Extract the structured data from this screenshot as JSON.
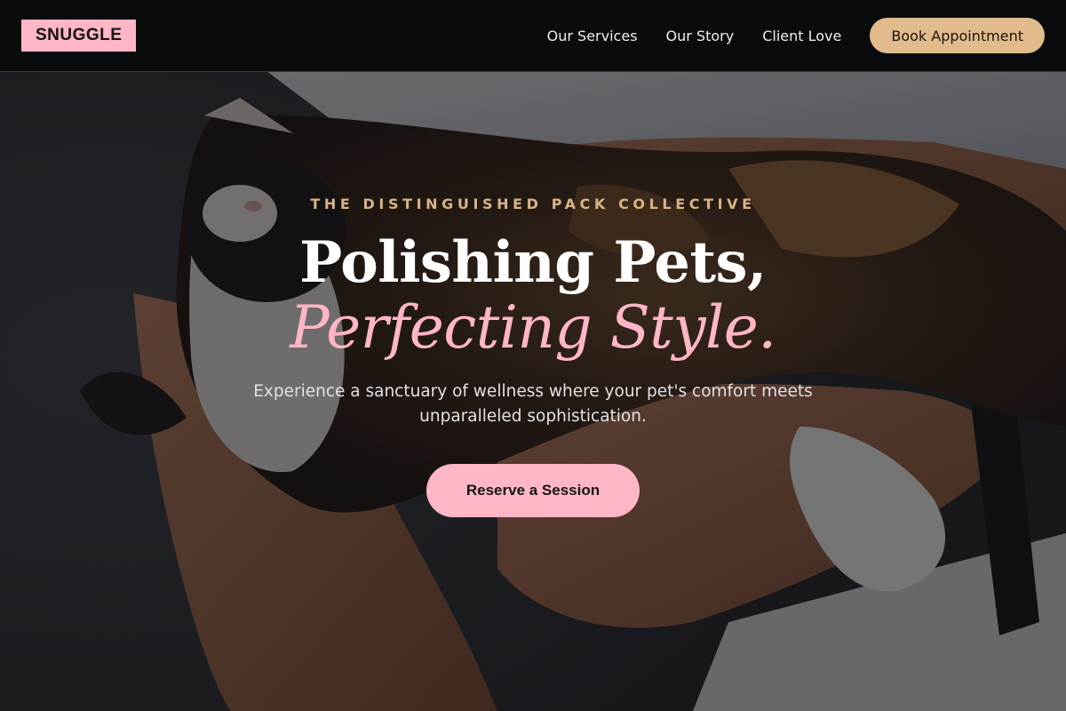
{
  "nav": {
    "logo": "SNUGGLE",
    "links": [
      {
        "label": "Our Services"
      },
      {
        "label": "Our Story"
      },
      {
        "label": "Client Love"
      }
    ],
    "cta_label": "Book Appointment"
  },
  "hero": {
    "eyebrow": "THE DISTINGUISHED PACK COLLECTIVE",
    "headline": "Polishing Pets,",
    "headline_accent": "Perfecting Style.",
    "subtitle": "Experience a sanctuary of wellness where your pet's comfort meets unparalleled sophistication.",
    "cta_label": "Reserve a Session",
    "background_image": "calico-cat-cuddled-in-arms-photo"
  },
  "colors": {
    "accent_pink": "#ffb6c6",
    "accent_gold": "#e2bb8c",
    "eyebrow_gold": "#d9b386",
    "navbar_bg": "#0a0b0d"
  }
}
